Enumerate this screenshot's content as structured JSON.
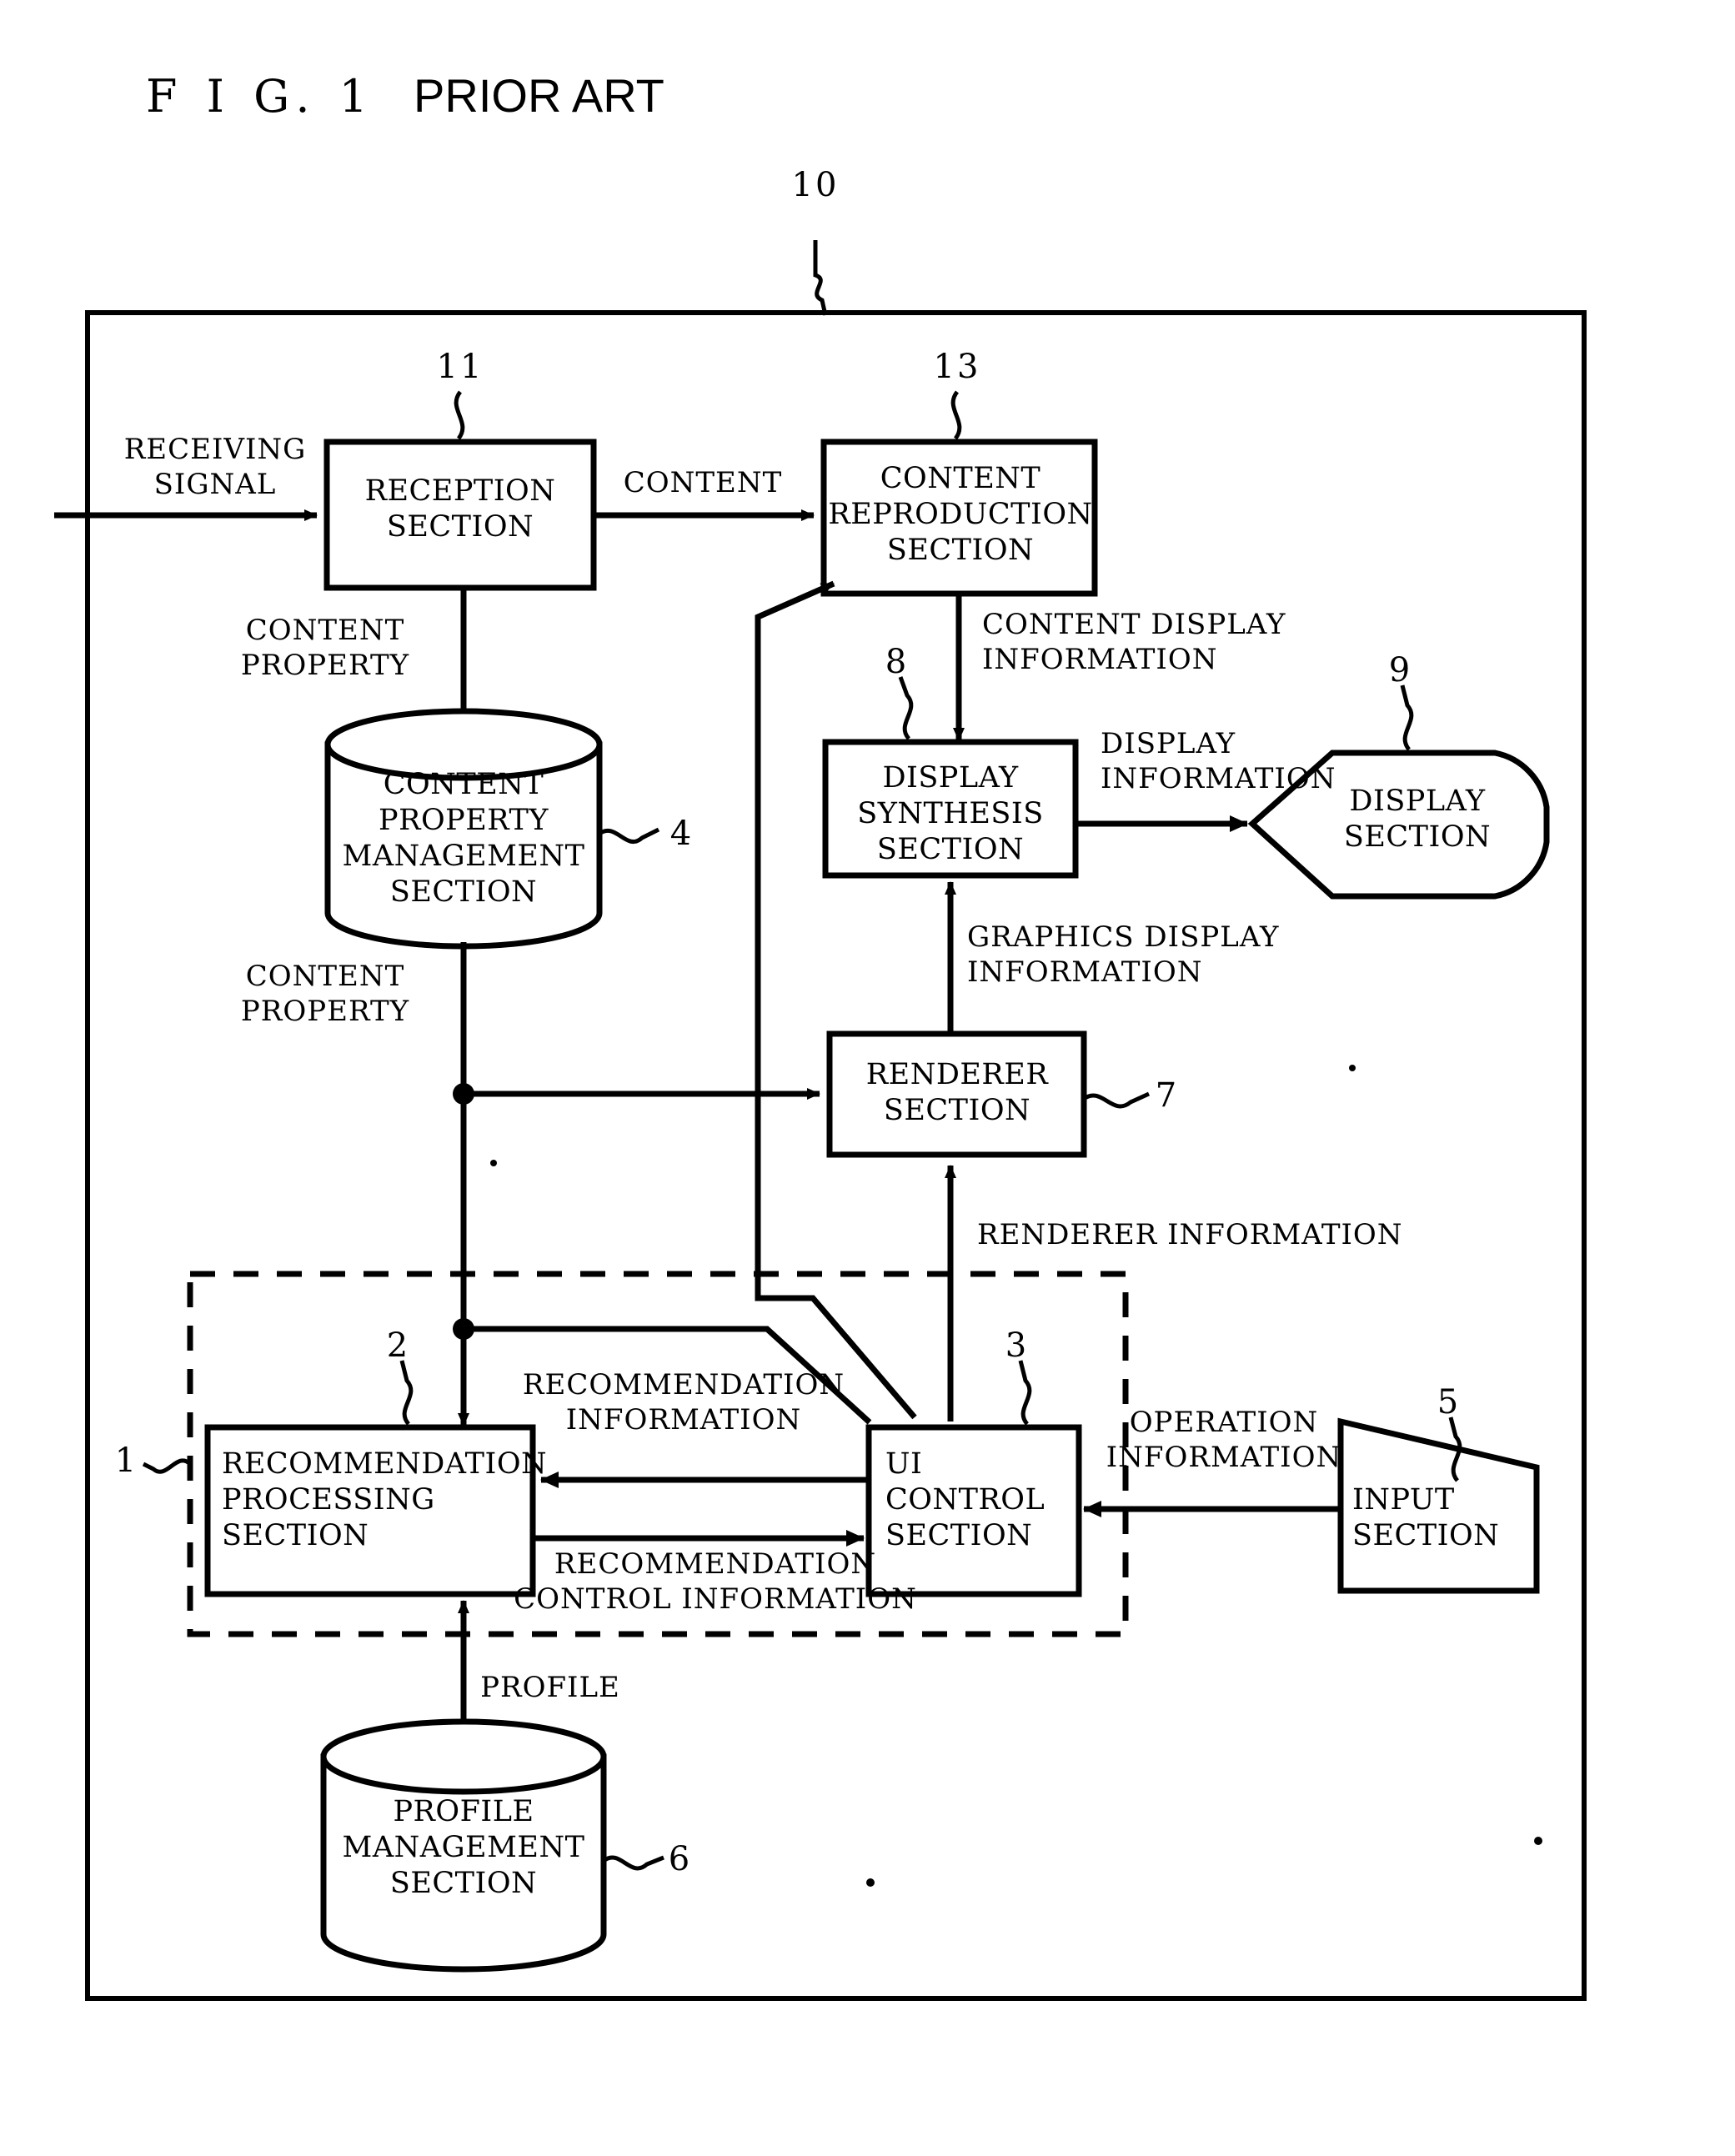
{
  "figure": {
    "number_label": "F I G.  1",
    "status_label": "PRIOR ART"
  },
  "system": {
    "outer_ref": "10",
    "dashed_group_ref": "1"
  },
  "blocks": [
    {
      "id": "reception",
      "ref": "11",
      "label": "RECEPTION\nSECTION",
      "shape": "rect"
    },
    {
      "id": "content-reproduction",
      "ref": "13",
      "label": "CONTENT\nREPRODUCTION\nSECTION",
      "shape": "rect"
    },
    {
      "id": "content-property-db",
      "ref": "4",
      "label": "CONTENT\nPROPERTY\nMANAGEMENT\nSECTION",
      "shape": "cylinder"
    },
    {
      "id": "display-synthesis",
      "ref": "8",
      "label": "DISPLAY\nSYNTHESIS\nSECTION",
      "shape": "rect"
    },
    {
      "id": "display",
      "ref": "9",
      "label": "DISPLAY\nSECTION",
      "shape": "display"
    },
    {
      "id": "renderer",
      "ref": "7",
      "label": "RENDERER\nSECTION",
      "shape": "rect"
    },
    {
      "id": "recommendation-processing",
      "ref": "2",
      "label": "RECOMMENDATION\nPROCESSING\nSECTION",
      "shape": "rect"
    },
    {
      "id": "ui-control",
      "ref": "3",
      "label": "UI\nCONTROL\nSECTION",
      "shape": "rect"
    },
    {
      "id": "input",
      "ref": "5",
      "label": "INPUT\nSECTION",
      "shape": "trapezoid"
    },
    {
      "id": "profile-db",
      "ref": "6",
      "label": "PROFILE\nMANAGEMENT\nSECTION",
      "shape": "cylinder"
    }
  ],
  "edge_labels": {
    "receiving_signal": "RECEIVING\nSIGNAL",
    "content": "CONTENT",
    "content_property_top": "CONTENT\nPROPERTY",
    "content_property_bottom": "CONTENT\nPROPERTY",
    "content_display_information": "CONTENT DISPLAY\nINFORMATION",
    "display_information": "DISPLAY\nINFORMATION",
    "graphics_display_information": "GRAPHICS DISPLAY\nINFORMATION",
    "renderer_information": "RENDERER INFORMATION",
    "recommendation_information": "RECOMMENDATION\nINFORMATION",
    "recommendation_control_information": "RECOMMENDATION\nCONTROL INFORMATION",
    "operation_information": "OPERATION\nINFORMATION",
    "profile": "PROFILE"
  },
  "box_labels": {
    "reception": "RECEPTION\nSECTION",
    "content_reproduction": "CONTENT\nREPRODUCTION\nSECTION",
    "content_property_db": "CONTENT\nPROPERTY\nMANAGEMENT\nSECTION",
    "display_synthesis": "DISPLAY\nSYNTHESIS\nSECTION",
    "display": "DISPLAY\nSECTION",
    "renderer": "RENDERER\nSECTION",
    "recommendation_processing": "RECOMMENDATION\nPROCESSING\nSECTION",
    "ui_control": "UI\nCONTROL\nSECTION",
    "input": "INPUT\nSECTION",
    "profile_db": "PROFILE\nMANAGEMENT\nSECTION"
  },
  "refs": {
    "outer": "10",
    "reception": "11",
    "content_reproduction": "13",
    "content_property_db": "4",
    "display_synthesis": "8",
    "display": "9",
    "renderer": "7",
    "dashed_group": "1",
    "recommendation_processing": "2",
    "ui_control": "3",
    "input": "5",
    "profile_db": "6"
  },
  "colors": {
    "ink": "#000000",
    "paper": "#ffffff"
  }
}
